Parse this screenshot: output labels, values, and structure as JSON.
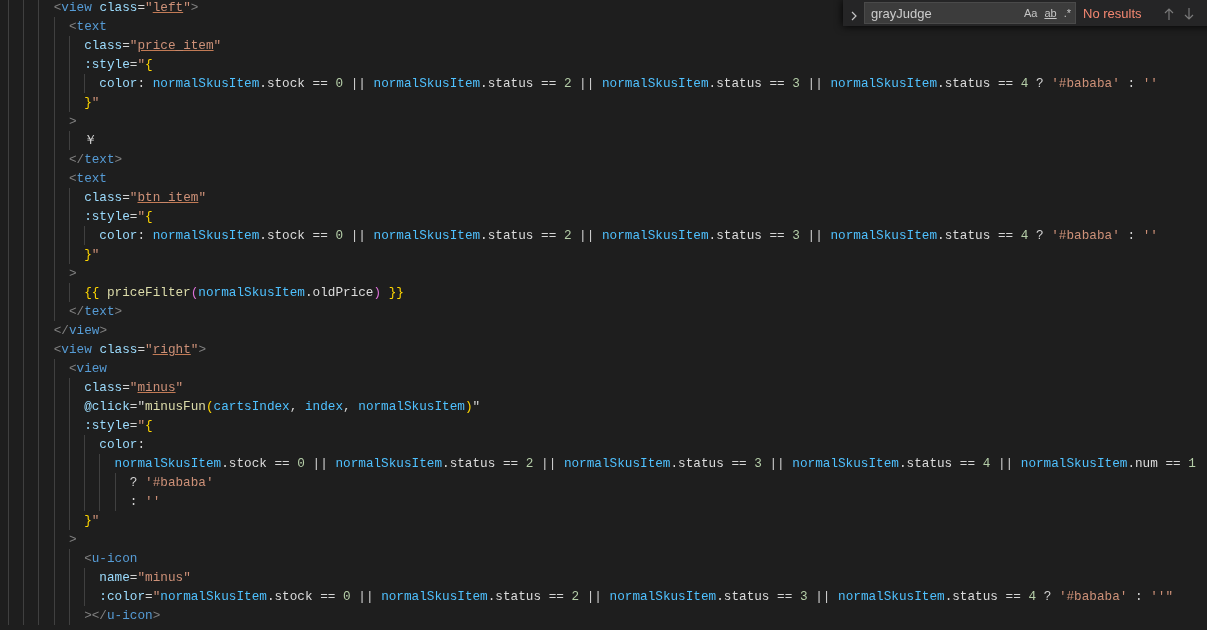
{
  "editor": {
    "lines": [
      {
        "tokens": [
          {
            "kind": "bracket",
            "text": "      <"
          },
          {
            "kind": "tag",
            "text": "view"
          },
          {
            "kind": "attr",
            "text": " class"
          },
          {
            "kind": "op",
            "text": "="
          },
          {
            "kind": "string",
            "text": "\""
          },
          {
            "kind": "classref",
            "text": "left"
          },
          {
            "kind": "string",
            "text": "\""
          },
          {
            "kind": "bracket",
            "text": ">"
          }
        ]
      },
      {
        "tokens": [
          {
            "kind": "bracket",
            "text": "        <"
          },
          {
            "kind": "tag",
            "text": "text"
          }
        ]
      },
      {
        "tokens": [
          {
            "kind": "attr",
            "text": "          class"
          },
          {
            "kind": "op",
            "text": "="
          },
          {
            "kind": "string",
            "text": "\""
          },
          {
            "kind": "classref",
            "text": "price_item"
          },
          {
            "kind": "string",
            "text": "\""
          }
        ]
      },
      {
        "tokens": [
          {
            "kind": "attr",
            "text": "          :style"
          },
          {
            "kind": "op",
            "text": "="
          },
          {
            "kind": "string",
            "text": "\""
          },
          {
            "kind": "brace",
            "text": "{"
          }
        ]
      },
      {
        "tokens": [
          {
            "kind": "attr",
            "text": "            color"
          },
          {
            "kind": "op",
            "text": ": "
          },
          {
            "kind": "var",
            "text": "normalSkusItem"
          },
          {
            "kind": "prop",
            "text": ".stock"
          },
          {
            "kind": "op",
            "text": " == "
          },
          {
            "kind": "number",
            "text": "0"
          },
          {
            "kind": "op",
            "text": " || "
          },
          {
            "kind": "var",
            "text": "normalSkusItem"
          },
          {
            "kind": "prop",
            "text": ".status"
          },
          {
            "kind": "op",
            "text": " == "
          },
          {
            "kind": "number",
            "text": "2"
          },
          {
            "kind": "op",
            "text": " || "
          },
          {
            "kind": "var",
            "text": "normalSkusItem"
          },
          {
            "kind": "prop",
            "text": ".status"
          },
          {
            "kind": "op",
            "text": " == "
          },
          {
            "kind": "number",
            "text": "3"
          },
          {
            "kind": "op",
            "text": " || "
          },
          {
            "kind": "var",
            "text": "normalSkusItem"
          },
          {
            "kind": "prop",
            "text": ".status"
          },
          {
            "kind": "op",
            "text": " == "
          },
          {
            "kind": "number",
            "text": "4"
          },
          {
            "kind": "op",
            "text": " ? "
          },
          {
            "kind": "string",
            "text": "'#bababa'"
          },
          {
            "kind": "op",
            "text": " : "
          },
          {
            "kind": "string",
            "text": "''"
          }
        ]
      },
      {
        "tokens": [
          {
            "kind": "brace",
            "text": "          }"
          },
          {
            "kind": "string",
            "text": "\""
          }
        ]
      },
      {
        "tokens": [
          {
            "kind": "bracket",
            "text": "        >"
          }
        ]
      },
      {
        "tokens": [
          {
            "kind": "content",
            "text": "          ￥"
          }
        ]
      },
      {
        "tokens": [
          {
            "kind": "bracket",
            "text": "        </"
          },
          {
            "kind": "tag",
            "text": "text"
          },
          {
            "kind": "bracket",
            "text": ">"
          }
        ]
      },
      {
        "tokens": [
          {
            "kind": "bracket",
            "text": "        <"
          },
          {
            "kind": "tag",
            "text": "text"
          }
        ]
      },
      {
        "tokens": [
          {
            "kind": "attr",
            "text": "          class"
          },
          {
            "kind": "op",
            "text": "="
          },
          {
            "kind": "string",
            "text": "\""
          },
          {
            "kind": "classref",
            "text": "btn_item"
          },
          {
            "kind": "string",
            "text": "\""
          }
        ]
      },
      {
        "tokens": [
          {
            "kind": "attr",
            "text": "          :style"
          },
          {
            "kind": "op",
            "text": "="
          },
          {
            "kind": "string",
            "text": "\""
          },
          {
            "kind": "brace",
            "text": "{"
          }
        ]
      },
      {
        "tokens": [
          {
            "kind": "attr",
            "text": "            color"
          },
          {
            "kind": "op",
            "text": ": "
          },
          {
            "kind": "var",
            "text": "normalSkusItem"
          },
          {
            "kind": "prop",
            "text": ".stock"
          },
          {
            "kind": "op",
            "text": " == "
          },
          {
            "kind": "number",
            "text": "0"
          },
          {
            "kind": "op",
            "text": " || "
          },
          {
            "kind": "var",
            "text": "normalSkusItem"
          },
          {
            "kind": "prop",
            "text": ".status"
          },
          {
            "kind": "op",
            "text": " == "
          },
          {
            "kind": "number",
            "text": "2"
          },
          {
            "kind": "op",
            "text": " || "
          },
          {
            "kind": "var",
            "text": "normalSkusItem"
          },
          {
            "kind": "prop",
            "text": ".status"
          },
          {
            "kind": "op",
            "text": " == "
          },
          {
            "kind": "number",
            "text": "3"
          },
          {
            "kind": "op",
            "text": " || "
          },
          {
            "kind": "var",
            "text": "normalSkusItem"
          },
          {
            "kind": "prop",
            "text": ".status"
          },
          {
            "kind": "op",
            "text": " == "
          },
          {
            "kind": "number",
            "text": "4"
          },
          {
            "kind": "op",
            "text": " ? "
          },
          {
            "kind": "string",
            "text": "'#bababa'"
          },
          {
            "kind": "op",
            "text": " : "
          },
          {
            "kind": "string",
            "text": "''"
          }
        ]
      },
      {
        "tokens": [
          {
            "kind": "brace",
            "text": "          }"
          },
          {
            "kind": "string",
            "text": "\""
          }
        ]
      },
      {
        "tokens": [
          {
            "kind": "bracket",
            "text": "        >"
          }
        ]
      },
      {
        "tokens": [
          {
            "kind": "brace",
            "text": "          {{ "
          },
          {
            "kind": "func",
            "text": "priceFilter"
          },
          {
            "kind": "paren",
            "text": "("
          },
          {
            "kind": "var",
            "text": "normalSkusItem"
          },
          {
            "kind": "prop",
            "text": ".oldPrice"
          },
          {
            "kind": "paren",
            "text": ")"
          },
          {
            "kind": "brace",
            "text": " }}"
          }
        ]
      },
      {
        "tokens": [
          {
            "kind": "bracket",
            "text": "        </"
          },
          {
            "kind": "tag",
            "text": "text"
          },
          {
            "kind": "bracket",
            "text": ">"
          }
        ]
      },
      {
        "tokens": [
          {
            "kind": "bracket",
            "text": "      </"
          },
          {
            "kind": "tag",
            "text": "view"
          },
          {
            "kind": "bracket",
            "text": ">"
          }
        ]
      },
      {
        "tokens": [
          {
            "kind": "bracket",
            "text": "      <"
          },
          {
            "kind": "tag",
            "text": "view"
          },
          {
            "kind": "attr",
            "text": " class"
          },
          {
            "kind": "op",
            "text": "="
          },
          {
            "kind": "string",
            "text": "\""
          },
          {
            "kind": "classref",
            "text": "right"
          },
          {
            "kind": "string",
            "text": "\""
          },
          {
            "kind": "bracket",
            "text": ">"
          }
        ]
      },
      {
        "tokens": [
          {
            "kind": "bracket",
            "text": "        <"
          },
          {
            "kind": "tag",
            "text": "view"
          }
        ]
      },
      {
        "tokens": [
          {
            "kind": "attr",
            "text": "          class"
          },
          {
            "kind": "op",
            "text": "="
          },
          {
            "kind": "string",
            "text": "\""
          },
          {
            "kind": "classref",
            "text": "minus"
          },
          {
            "kind": "string",
            "text": "\""
          }
        ]
      },
      {
        "tokens": [
          {
            "kind": "attr",
            "text": "          @click"
          },
          {
            "kind": "op",
            "text": "=\""
          },
          {
            "kind": "func",
            "text": "minusFun"
          },
          {
            "kind": "brace",
            "text": "("
          },
          {
            "kind": "var",
            "text": "cartsIndex"
          },
          {
            "kind": "op",
            "text": ", "
          },
          {
            "kind": "var",
            "text": "index"
          },
          {
            "kind": "op",
            "text": ", "
          },
          {
            "kind": "var",
            "text": "normalSkusItem"
          },
          {
            "kind": "brace",
            "text": ")"
          },
          {
            "kind": "op",
            "text": "\""
          }
        ]
      },
      {
        "tokens": [
          {
            "kind": "attr",
            "text": "          :style"
          },
          {
            "kind": "op",
            "text": "="
          },
          {
            "kind": "string",
            "text": "\""
          },
          {
            "kind": "brace",
            "text": "{"
          }
        ]
      },
      {
        "tokens": [
          {
            "kind": "attr",
            "text": "            color"
          },
          {
            "kind": "op",
            "text": ":"
          }
        ]
      },
      {
        "tokens": [
          {
            "kind": "var",
            "text": "              normalSkusItem"
          },
          {
            "kind": "prop",
            "text": ".stock"
          },
          {
            "kind": "op",
            "text": " == "
          },
          {
            "kind": "number",
            "text": "0"
          },
          {
            "kind": "op",
            "text": " || "
          },
          {
            "kind": "var",
            "text": "normalSkusItem"
          },
          {
            "kind": "prop",
            "text": ".status"
          },
          {
            "kind": "op",
            "text": " == "
          },
          {
            "kind": "number",
            "text": "2"
          },
          {
            "kind": "op",
            "text": " || "
          },
          {
            "kind": "var",
            "text": "normalSkusItem"
          },
          {
            "kind": "prop",
            "text": ".status"
          },
          {
            "kind": "op",
            "text": " == "
          },
          {
            "kind": "number",
            "text": "3"
          },
          {
            "kind": "op",
            "text": " || "
          },
          {
            "kind": "var",
            "text": "normalSkusItem"
          },
          {
            "kind": "prop",
            "text": ".status"
          },
          {
            "kind": "op",
            "text": " == "
          },
          {
            "kind": "number",
            "text": "4"
          },
          {
            "kind": "op",
            "text": " || "
          },
          {
            "kind": "var",
            "text": "normalSkusItem"
          },
          {
            "kind": "prop",
            "text": ".num"
          },
          {
            "kind": "op",
            "text": " == "
          },
          {
            "kind": "number",
            "text": "1"
          }
        ]
      },
      {
        "tokens": [
          {
            "kind": "op",
            "text": "                ? "
          },
          {
            "kind": "string",
            "text": "'#bababa'"
          }
        ]
      },
      {
        "tokens": [
          {
            "kind": "op",
            "text": "                : "
          },
          {
            "kind": "string",
            "text": "''"
          }
        ]
      },
      {
        "tokens": [
          {
            "kind": "brace",
            "text": "          }"
          },
          {
            "kind": "string",
            "text": "\""
          }
        ]
      },
      {
        "tokens": [
          {
            "kind": "bracket",
            "text": "        >"
          }
        ]
      },
      {
        "tokens": [
          {
            "kind": "bracket",
            "text": "          <"
          },
          {
            "kind": "tag",
            "text": "u-icon"
          }
        ]
      },
      {
        "tokens": [
          {
            "kind": "attr",
            "text": "            name"
          },
          {
            "kind": "op",
            "text": "="
          },
          {
            "kind": "string",
            "text": "\"minus\""
          }
        ]
      },
      {
        "tokens": [
          {
            "kind": "attr",
            "text": "            :color"
          },
          {
            "kind": "op",
            "text": "="
          },
          {
            "kind": "string",
            "text": "\""
          },
          {
            "kind": "var",
            "text": "normalSkusItem"
          },
          {
            "kind": "prop",
            "text": ".stock"
          },
          {
            "kind": "op",
            "text": " == "
          },
          {
            "kind": "number",
            "text": "0"
          },
          {
            "kind": "op",
            "text": " || "
          },
          {
            "kind": "var",
            "text": "normalSkusItem"
          },
          {
            "kind": "prop",
            "text": ".status"
          },
          {
            "kind": "op",
            "text": " == "
          },
          {
            "kind": "number",
            "text": "2"
          },
          {
            "kind": "op",
            "text": " || "
          },
          {
            "kind": "var",
            "text": "normalSkusItem"
          },
          {
            "kind": "prop",
            "text": ".status"
          },
          {
            "kind": "op",
            "text": " == "
          },
          {
            "kind": "number",
            "text": "3"
          },
          {
            "kind": "op",
            "text": " || "
          },
          {
            "kind": "var",
            "text": "normalSkusItem"
          },
          {
            "kind": "prop",
            "text": ".status"
          },
          {
            "kind": "op",
            "text": " == "
          },
          {
            "kind": "number",
            "text": "4"
          },
          {
            "kind": "op",
            "text": " ? "
          },
          {
            "kind": "string",
            "text": "'#bababa'"
          },
          {
            "kind": "op",
            "text": " : "
          },
          {
            "kind": "string",
            "text": "''\""
          }
        ]
      },
      {
        "tokens": [
          {
            "kind": "bracket",
            "text": "          ></"
          },
          {
            "kind": "tag",
            "text": "u-icon"
          },
          {
            "kind": "bracket",
            "text": ">"
          }
        ]
      }
    ]
  },
  "find_widget": {
    "value": "grayJudge",
    "match_case": "Aa",
    "whole_word": "ab",
    "regex": ".*",
    "result": "No results"
  }
}
